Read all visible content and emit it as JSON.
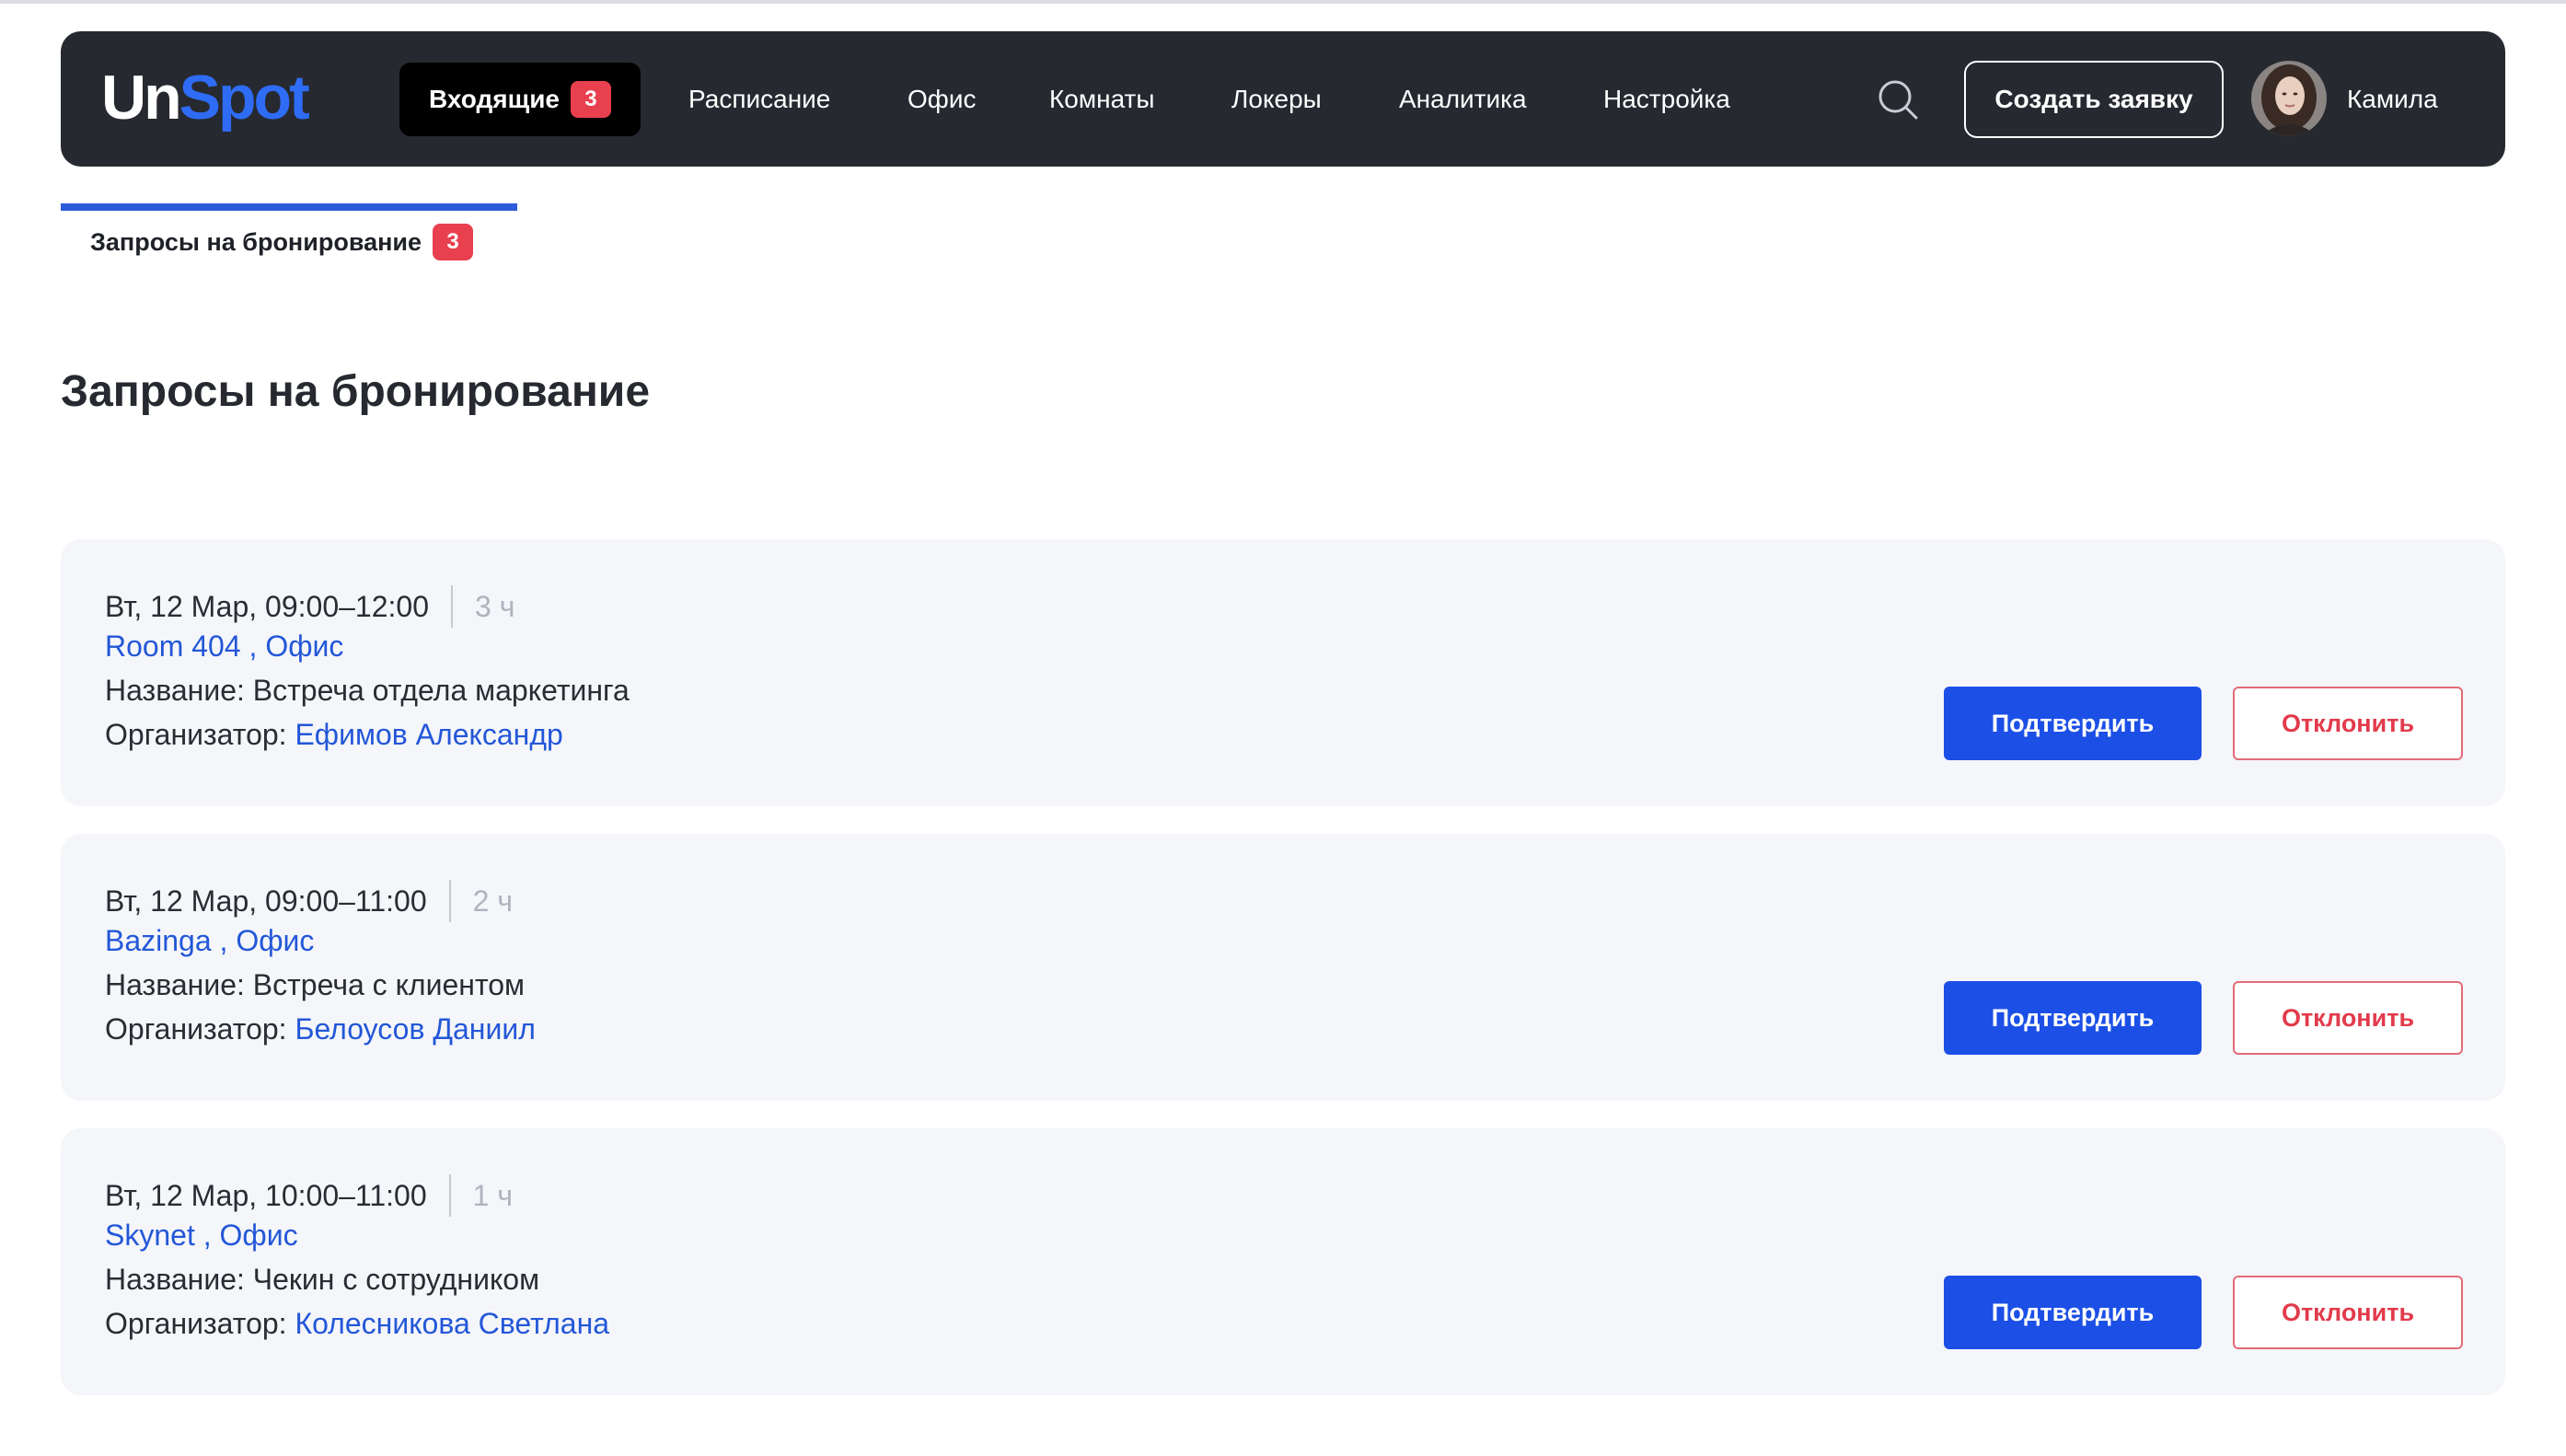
{
  "header": {
    "logo_first": "Un",
    "logo_second": "Spot",
    "nav": {
      "inbox_label": "Входящие",
      "inbox_count": "3",
      "items": [
        "Расписание",
        "Офис",
        "Комнаты",
        "Локеры",
        "Аналитика",
        "Настройка"
      ]
    },
    "search_icon": "search-icon",
    "create_button": "Создать заявку",
    "user_name": "Камила"
  },
  "tabs": [
    {
      "label": "Запросы на бронирование",
      "count": "3",
      "active": true
    }
  ],
  "page_title": "Запросы на бронирование",
  "requests": [
    {
      "datetime": "Вт, 12 Мар, 09:00–12:00",
      "duration": "3 ч",
      "location": "Room 404 , Офис",
      "name_label": "Название:",
      "name": "Встреча отдела маркетинга",
      "organizer_label": "Организатор:",
      "organizer": "Ефимов Александр",
      "confirm_label": "Подтвердить",
      "reject_label": "Отклонить"
    },
    {
      "datetime": "Вт, 12 Мар, 09:00–11:00",
      "duration": "2 ч",
      "location": "Bazinga , Офис",
      "name_label": "Название:",
      "name": "Встреча с клиентом",
      "organizer_label": "Организатор:",
      "organizer": "Белоусов Даниил",
      "confirm_label": "Подтвердить",
      "reject_label": "Отклонить"
    },
    {
      "datetime": "Вт, 12 Мар, 10:00–11:00",
      "duration": "1 ч",
      "location": "Skynet , Офис",
      "name_label": "Название:",
      "name": "Чекин с сотрудником",
      "organizer_label": "Организатор:",
      "organizer": "Колесникова Светлана",
      "confirm_label": "Подтвердить",
      "reject_label": "Отклонить"
    }
  ],
  "colors": {
    "header_bg": "#262930",
    "accent_blue": "#1b4fe6",
    "link_blue": "#2357d8",
    "badge_red": "#e8404f",
    "reject_red": "#e23b4c",
    "card_bg": "#f5f6fa"
  }
}
